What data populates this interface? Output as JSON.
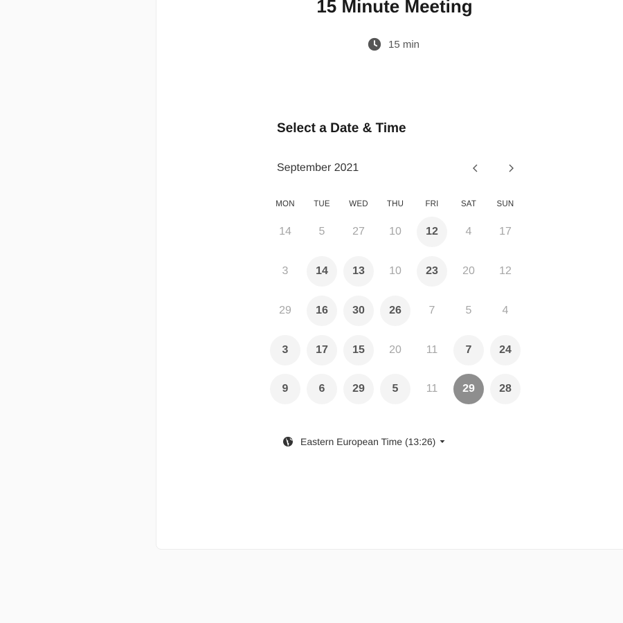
{
  "event": {
    "title": "15 Minute Meeting",
    "duration": "15 min",
    "duration_icon": "clock-icon"
  },
  "scheduler": {
    "heading": "Select a Date & Time",
    "month": "September 2021",
    "prev_icon": "chevron-left-icon",
    "next_icon": "chevron-right-icon",
    "weekdays": [
      "MON",
      "TUE",
      "WED",
      "THU",
      "FRI",
      "SAT",
      "SUN"
    ],
    "weeks": [
      [
        {
          "label": "14",
          "state": "unavailable"
        },
        {
          "label": "5",
          "state": "unavailable"
        },
        {
          "label": "27",
          "state": "unavailable"
        },
        {
          "label": "10",
          "state": "unavailable"
        },
        {
          "label": "12",
          "state": "available"
        },
        {
          "label": "4",
          "state": "unavailable"
        },
        {
          "label": "17",
          "state": "unavailable"
        }
      ],
      [
        {
          "label": "3",
          "state": "unavailable"
        },
        {
          "label": "14",
          "state": "available"
        },
        {
          "label": "13",
          "state": "available"
        },
        {
          "label": "10",
          "state": "unavailable"
        },
        {
          "label": "23",
          "state": "available"
        },
        {
          "label": "20",
          "state": "unavailable"
        },
        {
          "label": "12",
          "state": "unavailable"
        }
      ],
      [
        {
          "label": "29",
          "state": "unavailable"
        },
        {
          "label": "16",
          "state": "available"
        },
        {
          "label": "30",
          "state": "available"
        },
        {
          "label": "26",
          "state": "available"
        },
        {
          "label": "7",
          "state": "unavailable"
        },
        {
          "label": "5",
          "state": "unavailable"
        },
        {
          "label": "4",
          "state": "unavailable"
        }
      ],
      [
        {
          "label": "3",
          "state": "available"
        },
        {
          "label": "17",
          "state": "available"
        },
        {
          "label": "15",
          "state": "available"
        },
        {
          "label": "20",
          "state": "unavailable"
        },
        {
          "label": "11",
          "state": "unavailable"
        },
        {
          "label": "7",
          "state": "available"
        },
        {
          "label": "24",
          "state": "available"
        }
      ],
      [
        {
          "label": "9",
          "state": "available"
        },
        {
          "label": "6",
          "state": "available"
        },
        {
          "label": "29",
          "state": "available"
        },
        {
          "label": "5",
          "state": "available"
        },
        {
          "label": "11",
          "state": "unavailable"
        },
        {
          "label": "29",
          "state": "selected"
        },
        {
          "label": "28",
          "state": "available"
        }
      ]
    ],
    "timezone": "Eastern European Time (13:26)",
    "timezone_icon": "globe-icon"
  },
  "colors": {
    "selected_day": "#8e8e8e",
    "available_day_bg": "#f4f4f4",
    "page_background": "#fafafa"
  }
}
